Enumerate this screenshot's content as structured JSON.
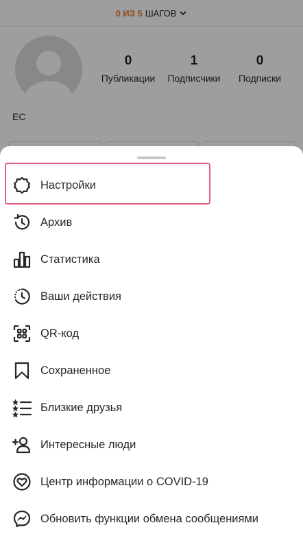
{
  "steps_banner": {
    "progress": "0 ИЗ 5",
    "label": "ШАГОВ"
  },
  "profile": {
    "username": "EC",
    "stats": [
      {
        "value": "0",
        "label": "Публикации"
      },
      {
        "value": "1",
        "label": "Подписчики"
      },
      {
        "value": "0",
        "label": "Подписки"
      }
    ]
  },
  "menu": {
    "items": [
      {
        "label": "Настройки",
        "icon": "settings-gear-icon"
      },
      {
        "label": "Архив",
        "icon": "archive-history-icon"
      },
      {
        "label": "Статистика",
        "icon": "statistics-bars-icon"
      },
      {
        "label": "Ваши действия",
        "icon": "activity-clock-icon"
      },
      {
        "label": "QR-код",
        "icon": "qr-code-icon"
      },
      {
        "label": "Сохраненное",
        "icon": "bookmark-icon"
      },
      {
        "label": "Близкие друзья",
        "icon": "close-friends-list-icon"
      },
      {
        "label": "Интересные люди",
        "icon": "add-person-icon"
      },
      {
        "label": "Центр информации о COVID-19",
        "icon": "covid-heart-icon"
      },
      {
        "label": "Обновить функции обмена сообщениями",
        "icon": "messenger-icon"
      }
    ]
  },
  "colors": {
    "accent": "#ed7d31",
    "highlight": "#e0607e",
    "text": "#262626"
  }
}
